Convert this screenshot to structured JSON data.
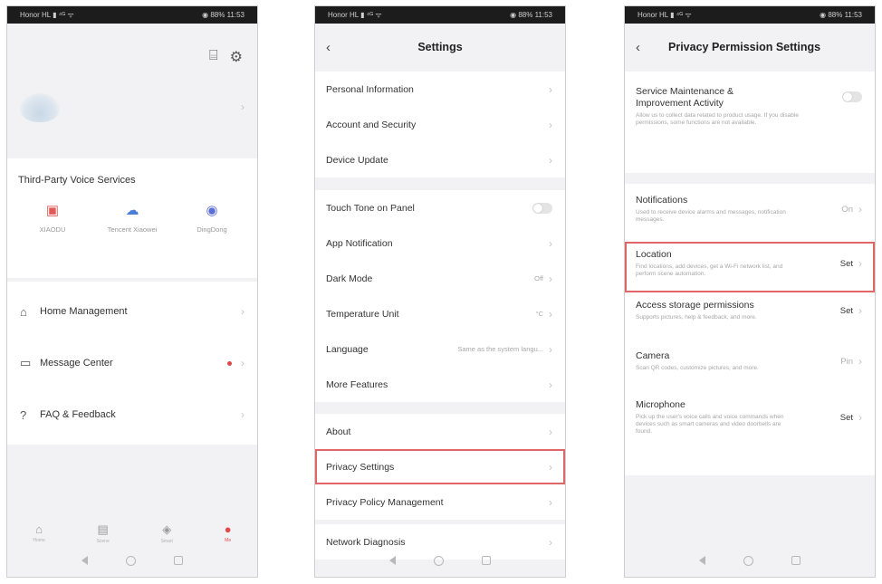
{
  "status_bar": {
    "left_text": "Honor HL  ▮ ⁴ᴳ ᯤ",
    "right_text": "◉ 88% 11:53"
  },
  "colors": {
    "accent_red": "#e24a4a",
    "highlight_border": "#e06767"
  },
  "screen1": {
    "top_icons": [
      "⌸",
      "⚙"
    ],
    "top_icon_names": [
      "scan-icon",
      "gear-icon"
    ],
    "section_title": "Third-Party Voice Services",
    "voice_services": [
      {
        "icon": "▣",
        "color": "#e05a5a",
        "label": "XIAODU"
      },
      {
        "icon": "☁",
        "color": "#4a7fd8",
        "label": "Tencent Xiaowei"
      },
      {
        "icon": "◉",
        "color": "#5b6fd8",
        "label": "DingDong"
      }
    ],
    "menu": [
      {
        "icon": "⌂",
        "label": "Home Management",
        "dot": false
      },
      {
        "icon": "▭",
        "label": "Message Center",
        "dot": true
      },
      {
        "icon": "?",
        "label": "FAQ & Feedback",
        "dot": false
      }
    ],
    "tabs": [
      {
        "icon": "⌂",
        "label": "Home"
      },
      {
        "icon": "▤",
        "label": "Scene"
      },
      {
        "icon": "◈",
        "label": "Smart"
      },
      {
        "icon": "●",
        "label": "Me"
      }
    ]
  },
  "screen2": {
    "title": "Settings",
    "groups": [
      [
        "Personal Information",
        "Account and Security",
        "Device Update"
      ],
      [
        "Touch Tone on Panel",
        "App Notification",
        "Dark Mode",
        "Temperature Unit",
        "Language",
        "More Features"
      ],
      [
        "About",
        "Privacy Settings",
        "Privacy Policy Management"
      ],
      [
        "Network Diagnosis"
      ]
    ],
    "values": {
      "dark_mode": "Off",
      "temperature_unit": "°C",
      "language": "Same as the system langu..."
    }
  },
  "screen3": {
    "title": "Privacy Permission Settings",
    "items": [
      {
        "title": "Service Maintenance & Improvement Activity",
        "desc": "Allow us to collect data related to product usage. If you disable permissions, some functions are not available.",
        "status": ""
      },
      {
        "title": "Notifications",
        "desc": "Used to receive device alarms and messages, notification messages.",
        "status": "On"
      },
      {
        "title": "Location",
        "desc": "Find locations, add devices, get a Wi-Fi network list, and perform scene automation.",
        "status": "Set"
      },
      {
        "title": "Access storage permissions",
        "desc": "Supports pictures, help & feedback, and more.",
        "status": "Set"
      },
      {
        "title": "Camera",
        "desc": "Scan QR codes, customize pictures, and more.",
        "status": "Pin"
      },
      {
        "title": "Microphone",
        "desc": "Pick up the user's voice calls and voice commands when devices such as smart cameras and video doorbells are found.",
        "status": "Set"
      }
    ]
  }
}
